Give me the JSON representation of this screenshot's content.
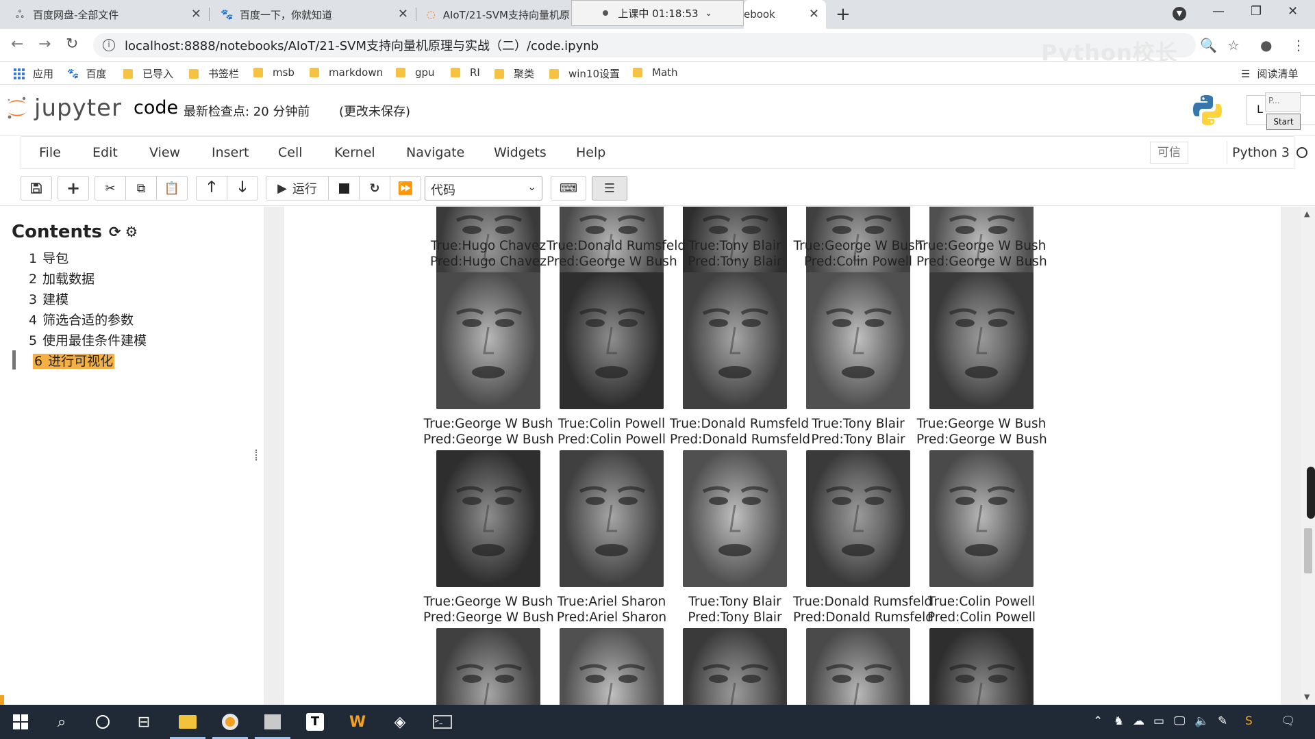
{
  "browser": {
    "tabs": [
      {
        "title": "百度网盘-全部文件",
        "icon": "baidu-netdisk-icon"
      },
      {
        "title": "百度一下，你就知道",
        "icon": "baidu-paw-icon"
      },
      {
        "title": "AIoT/21-SVM支持向量机原",
        "icon": "jupyter-icon"
      },
      {
        "title": "ebook",
        "icon": "jupyter-icon"
      }
    ],
    "recording_popup": "上课中 01:18:53",
    "url": "localhost:8888/notebooks/AIoT/21-SVM支持向量机原理与实战（二）/code.ipynb",
    "watermark": "Python校长"
  },
  "bookmarks": [
    {
      "label": "应用",
      "icon": "apps-grid-icon"
    },
    {
      "label": "百度",
      "icon": "baidu-paw-icon"
    },
    {
      "label": "已导入",
      "icon": "folder-icon"
    },
    {
      "label": "书签栏",
      "icon": "folder-icon"
    },
    {
      "label": "msb",
      "icon": "folder-icon"
    },
    {
      "label": "markdown",
      "icon": "folder-icon"
    },
    {
      "label": "gpu",
      "icon": "folder-icon"
    },
    {
      "label": "RI",
      "icon": "folder-icon"
    },
    {
      "label": "聚类",
      "icon": "folder-icon"
    },
    {
      "label": "win10设置",
      "icon": "folder-icon"
    },
    {
      "label": "Math",
      "icon": "folder-icon"
    }
  ],
  "reading_list": "阅读清单",
  "jupyter": {
    "logo_text": "jupyter",
    "notebook_name": "code",
    "checkpoint": "最新检查点: 20 分钟前",
    "unsaved": "(更改未保存)",
    "logout_partial": "L",
    "popup_p": "P...",
    "popup_start": "Start"
  },
  "menu": [
    "File",
    "Edit",
    "View",
    "Insert",
    "Cell",
    "Kernel",
    "Navigate",
    "Widgets",
    "Help"
  ],
  "trusted": "可信",
  "kernel": "Python 3",
  "toolbar": {
    "run_label": "运行",
    "cell_type": "代码"
  },
  "toc": {
    "title": "Contents",
    "items": [
      {
        "num": "1",
        "label": "导包"
      },
      {
        "num": "2",
        "label": "加载数据"
      },
      {
        "num": "3",
        "label": "建模"
      },
      {
        "num": "4",
        "label": "筛选合适的参数"
      },
      {
        "num": "5",
        "label": "使用最佳条件建模"
      },
      {
        "num": "6",
        "label": "进行可视化"
      }
    ]
  },
  "faces": {
    "row0_labels": [
      {
        "true": "True:Hugo Chavez",
        "pred": "Pred:Hugo Chavez"
      },
      {
        "true": "True:Donald Rumsfeld",
        "pred": "Pred:George W Bush"
      },
      {
        "true": "True:Tony Blair",
        "pred": "Pred:Tony Blair"
      },
      {
        "true": "True:George W Bush",
        "pred": "Pred:Colin Powell"
      },
      {
        "true": "True:George W Bush",
        "pred": "Pred:George W Bush"
      }
    ],
    "row1_labels": [
      {
        "true": "True:George W Bush",
        "pred": "Pred:George W Bush"
      },
      {
        "true": "True:Colin Powell",
        "pred": "Pred:Colin Powell"
      },
      {
        "true": "True:Donald Rumsfeld",
        "pred": "Pred:Donald Rumsfeld"
      },
      {
        "true": "True:Tony Blair",
        "pred": "Pred:Tony Blair"
      },
      {
        "true": "True:George W Bush",
        "pred": "Pred:George W Bush"
      }
    ],
    "row2_labels": [
      {
        "true": "True:George W Bush",
        "pred": "Pred:George W Bush"
      },
      {
        "true": "True:Ariel Sharon",
        "pred": "Pred:Ariel Sharon"
      },
      {
        "true": "True:Tony Blair",
        "pred": "Pred:Tony Blair"
      },
      {
        "true": "True:Donald Rumsfeld",
        "pred": "Pred:Donald Rumsfeld"
      },
      {
        "true": "True:Colin Powell",
        "pred": "Pred:Colin Powell"
      }
    ]
  },
  "colors": {
    "toc_highlight": "#f4b042",
    "taskbar": "#1f2a36",
    "tabstrip": "#dee1e6"
  }
}
